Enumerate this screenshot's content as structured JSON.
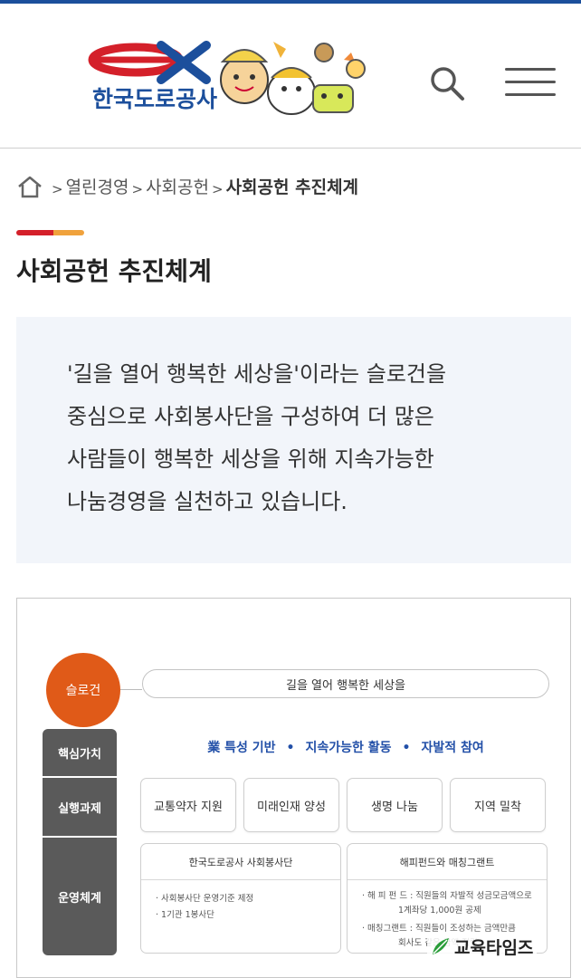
{
  "header": {
    "logo_text": "한국도로공사",
    "logo_mark": "ex",
    "search_icon": "search-icon",
    "menu_icon": "hamburger-menu-icon"
  },
  "breadcrumb": {
    "home_icon": "home-icon",
    "items": [
      "열린경영",
      "사회공헌"
    ],
    "current": "사회공헌 추진체계",
    "sep": ">"
  },
  "page": {
    "title": "사회공헌 추진체계",
    "intro_lines": [
      "'길을 열어 행복한 세상을'이라는 슬로건을",
      "중심으로 사회봉사단을 구성하여 더 많은",
      "사람들이 행복한 세상을 위해 지속가능한",
      "나눔경영을 실천하고 있습니다."
    ]
  },
  "diagram": {
    "slogan_label": "슬로건",
    "slogan_text": "길을 열어 행복한 세상을",
    "rows": {
      "core": "핵심가치",
      "tasks": "실행과제",
      "ops": "운영체계"
    },
    "core_values": [
      "業 특성 기반",
      "지속가능한 활동",
      "자발적 참여"
    ],
    "core_sep": "•",
    "tasks": [
      "교통약자 지원",
      "미래인재 양성",
      "생명 나눔",
      "지역 밀착"
    ],
    "op_left": {
      "title": "한국도로공사 사회봉사단",
      "lines": [
        "· 사회봉사단 운영기준 제정",
        "· 1기관 1봉사단"
      ]
    },
    "op_right": {
      "title": "해피펀드와 매칭그랜트",
      "lines": [
        "· 해 피 펀 드 : 직원들의 자발적 성금모금액으로",
        "1계좌당 1,000원 공제",
        "· 매칭그랜트 : 직원들이 조성하는 금액만큼",
        "회사도 같은 금액 적립"
      ]
    }
  },
  "watermark": {
    "text": "교육타임즈"
  },
  "colors": {
    "brand_blue": "#1c4f9c",
    "brand_red": "#d4202a",
    "accent_orange": "#e05a18",
    "value_blue": "#2350a8",
    "row_gray": "#5a5a5a"
  }
}
